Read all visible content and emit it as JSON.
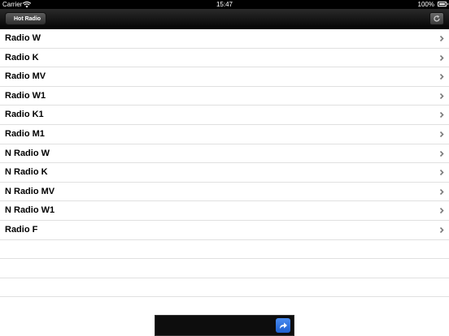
{
  "status_bar": {
    "carrier": "Carrier",
    "time": "15:47",
    "battery": "100%"
  },
  "nav_bar": {
    "back_label": "Hot Radio",
    "refresh_icon": "refresh-icon"
  },
  "stations": [
    {
      "label": "Radio W"
    },
    {
      "label": "Radio K"
    },
    {
      "label": "Radio MV"
    },
    {
      "label": "Radio W1"
    },
    {
      "label": "Radio K1"
    },
    {
      "label": "Radio M1"
    },
    {
      "label": "N Radio W"
    },
    {
      "label": "N Radio K"
    },
    {
      "label": "N Radio MV"
    },
    {
      "label": "N Radio W1"
    },
    {
      "label": "Radio F"
    }
  ],
  "ad": {
    "icon": "share-arrow-icon"
  },
  "colors": {
    "nav_bar": "#111111",
    "ad_button": "#2f6fe0"
  }
}
